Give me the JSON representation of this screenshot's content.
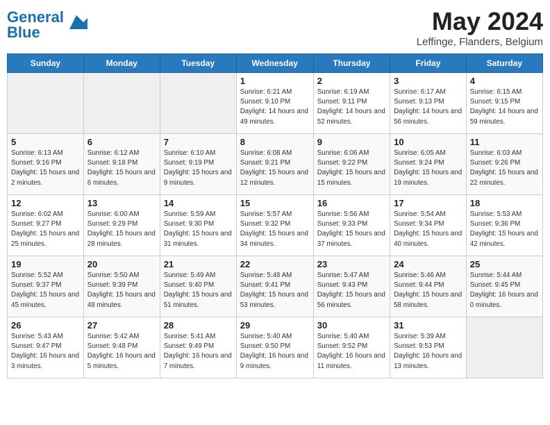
{
  "header": {
    "logo_text_general": "General",
    "logo_text_blue": "Blue",
    "month": "May 2024",
    "location": "Leffinge, Flanders, Belgium"
  },
  "days_of_week": [
    "Sunday",
    "Monday",
    "Tuesday",
    "Wednesday",
    "Thursday",
    "Friday",
    "Saturday"
  ],
  "weeks": [
    {
      "days": [
        {
          "num": "",
          "empty": true
        },
        {
          "num": "",
          "empty": true
        },
        {
          "num": "",
          "empty": true
        },
        {
          "num": "1",
          "sunrise": "6:21 AM",
          "sunset": "9:10 PM",
          "daylight": "14 hours and 49 minutes."
        },
        {
          "num": "2",
          "sunrise": "6:19 AM",
          "sunset": "9:11 PM",
          "daylight": "14 hours and 52 minutes."
        },
        {
          "num": "3",
          "sunrise": "6:17 AM",
          "sunset": "9:13 PM",
          "daylight": "14 hours and 56 minutes."
        },
        {
          "num": "4",
          "sunrise": "6:15 AM",
          "sunset": "9:15 PM",
          "daylight": "14 hours and 59 minutes."
        }
      ]
    },
    {
      "days": [
        {
          "num": "5",
          "sunrise": "6:13 AM",
          "sunset": "9:16 PM",
          "daylight": "15 hours and 2 minutes."
        },
        {
          "num": "6",
          "sunrise": "6:12 AM",
          "sunset": "9:18 PM",
          "daylight": "15 hours and 6 minutes."
        },
        {
          "num": "7",
          "sunrise": "6:10 AM",
          "sunset": "9:19 PM",
          "daylight": "15 hours and 9 minutes."
        },
        {
          "num": "8",
          "sunrise": "6:08 AM",
          "sunset": "9:21 PM",
          "daylight": "15 hours and 12 minutes."
        },
        {
          "num": "9",
          "sunrise": "6:06 AM",
          "sunset": "9:22 PM",
          "daylight": "15 hours and 15 minutes."
        },
        {
          "num": "10",
          "sunrise": "6:05 AM",
          "sunset": "9:24 PM",
          "daylight": "15 hours and 19 minutes."
        },
        {
          "num": "11",
          "sunrise": "6:03 AM",
          "sunset": "9:26 PM",
          "daylight": "15 hours and 22 minutes."
        }
      ]
    },
    {
      "days": [
        {
          "num": "12",
          "sunrise": "6:02 AM",
          "sunset": "9:27 PM",
          "daylight": "15 hours and 25 minutes."
        },
        {
          "num": "13",
          "sunrise": "6:00 AM",
          "sunset": "9:29 PM",
          "daylight": "15 hours and 28 minutes."
        },
        {
          "num": "14",
          "sunrise": "5:59 AM",
          "sunset": "9:30 PM",
          "daylight": "15 hours and 31 minutes."
        },
        {
          "num": "15",
          "sunrise": "5:57 AM",
          "sunset": "9:32 PM",
          "daylight": "15 hours and 34 minutes."
        },
        {
          "num": "16",
          "sunrise": "5:56 AM",
          "sunset": "9:33 PM",
          "daylight": "15 hours and 37 minutes."
        },
        {
          "num": "17",
          "sunrise": "5:54 AM",
          "sunset": "9:34 PM",
          "daylight": "15 hours and 40 minutes."
        },
        {
          "num": "18",
          "sunrise": "5:53 AM",
          "sunset": "9:36 PM",
          "daylight": "15 hours and 42 minutes."
        }
      ]
    },
    {
      "days": [
        {
          "num": "19",
          "sunrise": "5:52 AM",
          "sunset": "9:37 PM",
          "daylight": "15 hours and 45 minutes."
        },
        {
          "num": "20",
          "sunrise": "5:50 AM",
          "sunset": "9:39 PM",
          "daylight": "15 hours and 48 minutes."
        },
        {
          "num": "21",
          "sunrise": "5:49 AM",
          "sunset": "9:40 PM",
          "daylight": "15 hours and 51 minutes."
        },
        {
          "num": "22",
          "sunrise": "5:48 AM",
          "sunset": "9:41 PM",
          "daylight": "15 hours and 53 minutes."
        },
        {
          "num": "23",
          "sunrise": "5:47 AM",
          "sunset": "9:43 PM",
          "daylight": "15 hours and 56 minutes."
        },
        {
          "num": "24",
          "sunrise": "5:46 AM",
          "sunset": "9:44 PM",
          "daylight": "15 hours and 58 minutes."
        },
        {
          "num": "25",
          "sunrise": "5:44 AM",
          "sunset": "9:45 PM",
          "daylight": "16 hours and 0 minutes."
        }
      ]
    },
    {
      "days": [
        {
          "num": "26",
          "sunrise": "5:43 AM",
          "sunset": "9:47 PM",
          "daylight": "16 hours and 3 minutes."
        },
        {
          "num": "27",
          "sunrise": "5:42 AM",
          "sunset": "9:48 PM",
          "daylight": "16 hours and 5 minutes."
        },
        {
          "num": "28",
          "sunrise": "5:41 AM",
          "sunset": "9:49 PM",
          "daylight": "16 hours and 7 minutes."
        },
        {
          "num": "29",
          "sunrise": "5:40 AM",
          "sunset": "9:50 PM",
          "daylight": "16 hours and 9 minutes."
        },
        {
          "num": "30",
          "sunrise": "5:40 AM",
          "sunset": "9:52 PM",
          "daylight": "16 hours and 11 minutes."
        },
        {
          "num": "31",
          "sunrise": "5:39 AM",
          "sunset": "9:53 PM",
          "daylight": "16 hours and 13 minutes."
        },
        {
          "num": "",
          "empty": true
        }
      ]
    }
  ]
}
